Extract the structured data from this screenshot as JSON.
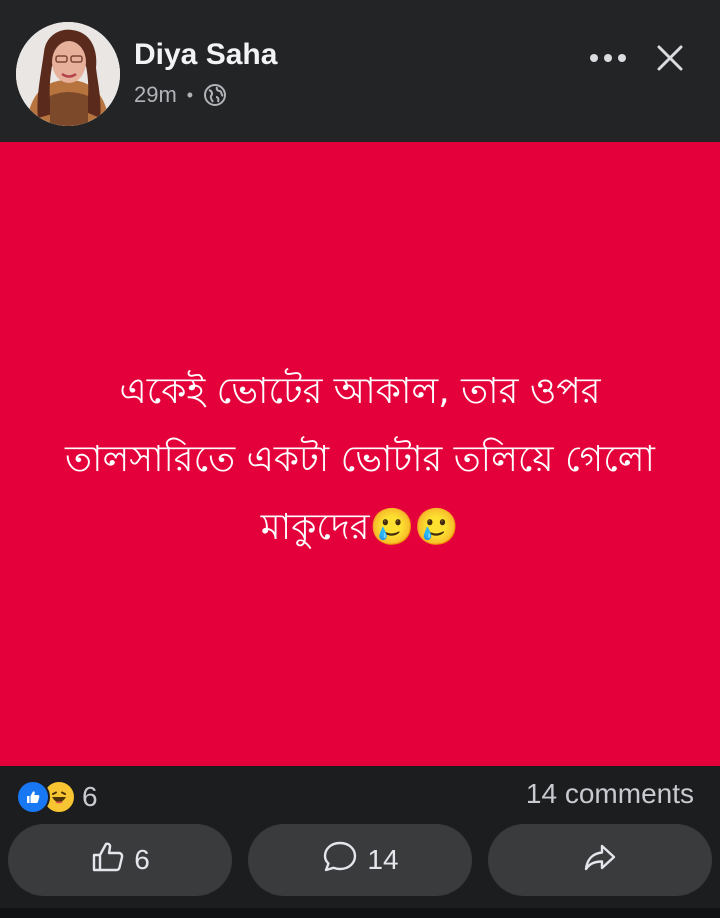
{
  "header": {
    "author_name": "Diya Saha",
    "timestamp": "29m",
    "separator": "•",
    "audience_icon": "globe-icon",
    "more_icon": "more-icon",
    "close_icon": "close-icon"
  },
  "post": {
    "background_color": "#e4003a",
    "text": "একেই ভোটের আকাল, তার ওপর তালসারিতে একটা ভোটার তলিয়ে গেলো মাকুদের🥲🥲"
  },
  "stats": {
    "reaction_icons": [
      "like-icon",
      "haha-icon"
    ],
    "reaction_count": "6",
    "comments_text": "14 comments"
  },
  "actions": {
    "like_count": "6",
    "comment_count": "14",
    "like_icon": "thumbs-up-icon",
    "comment_icon": "comment-bubble-icon",
    "share_icon": "share-icon"
  },
  "colors": {
    "like_blue": "#1877f2",
    "button_bg": "#3a3b3d",
    "page_bg": "#1c1d1f"
  }
}
